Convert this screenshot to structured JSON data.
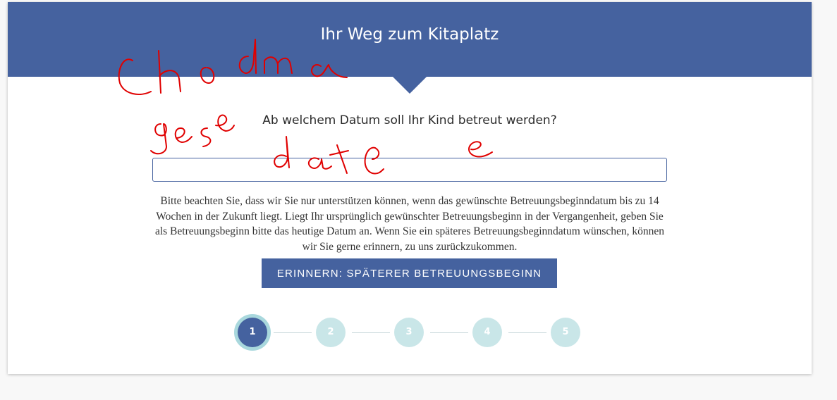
{
  "header": {
    "title": "Ihr Weg zum Kitaplatz"
  },
  "question": {
    "text": "Ab welchem Datum soll Ihr Kind betreut werden?"
  },
  "date_field": {
    "value": "",
    "placeholder": ""
  },
  "notice": {
    "text": "Bitte beachten Sie, dass wir Sie nur unterstützen können, wenn das gewünschte Betreuungsbeginndatum bis zu 14 Wochen in der Zukunft liegt. Liegt Ihr ursprünglich gewünschter Betreuungsbeginn in der Vergangenheit, geben Sie als Betreuungsbeginn bitte das heutige Datum an. Wenn Sie ein späteres Betreuungsbeginndatum wünschen, können wir Sie gerne erinnern, zu uns zurückzukommen."
  },
  "remind_button": {
    "label": "ERINNERN: SPÄTERER BETREUUNGSBEGINN"
  },
  "steps": [
    {
      "label": "1",
      "active": true
    },
    {
      "label": "2",
      "active": false
    },
    {
      "label": "3",
      "active": false
    },
    {
      "label": "4",
      "active": false
    },
    {
      "label": "5",
      "active": false
    }
  ],
  "colors": {
    "brand_blue": "#45629f",
    "step_inactive": "#c9e6e8",
    "step_ring": "#a9d8dd",
    "annotation_red": "#e00000"
  },
  "annotations": {
    "note": "Handwritten red scribbles overlaid on screenshot (illegible handwriting)"
  }
}
